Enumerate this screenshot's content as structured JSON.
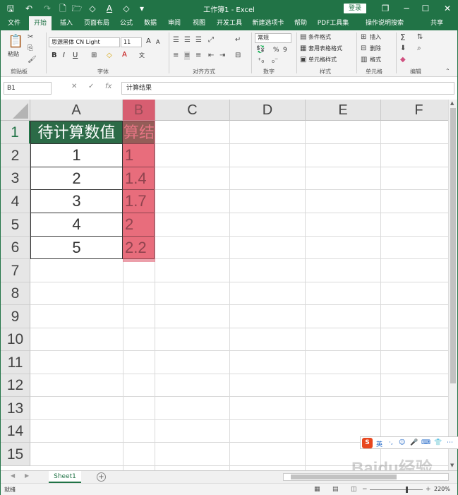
{
  "window": {
    "title": "工作簿1 - Excel",
    "login_label": "登录",
    "minimize": "─",
    "restore": "❐",
    "maximize": "☐",
    "close": "✕"
  },
  "quick_access": {
    "save": "🖫",
    "undo": "↶",
    "redo": "↷",
    "new": "🗋",
    "open": "🗁",
    "font_color": "A",
    "fill": "◇",
    "more": "▾"
  },
  "tabs": [
    "文件",
    "开始",
    "插入",
    "页面布局",
    "公式",
    "数据",
    "审阅",
    "视图",
    "开发工具",
    "新建选项卡",
    "帮助",
    "PDF工具集",
    "操作说明搜索",
    "共享"
  ],
  "active_tab": "开始",
  "ribbon": {
    "groups": {
      "clipboard": "剪贴板",
      "font": "字体",
      "alignment": "对齐方式",
      "number": "数字",
      "styles": "样式",
      "cells": "单元格",
      "editing": "编辑"
    },
    "paste_label": "粘贴",
    "font_name": "思源黑体 CN Light",
    "font_size": "11",
    "number_format": "常规",
    "percent": "%",
    "comma": "9",
    "styles_items": [
      "条件格式",
      "套用表格格式",
      "单元格样式"
    ],
    "cells_items": [
      "插入",
      "删除",
      "格式"
    ],
    "bold": "B",
    "italic": "I",
    "underline": "U",
    "grow_font": "A",
    "shrink_font": "A",
    "wen": "文"
  },
  "formula_bar": {
    "name_box": "B1",
    "cancel": "✕",
    "enter": "✓",
    "fx": "fx",
    "formula": "计算结果"
  },
  "sheet": {
    "columns": [
      "A",
      "B",
      "C",
      "D",
      "E",
      "F"
    ],
    "rows": [
      "1",
      "2",
      "3",
      "4",
      "5",
      "6",
      "7",
      "8",
      "9",
      "10",
      "11",
      "12",
      "13",
      "14",
      "15"
    ],
    "selected_column": "B",
    "selected_row": "1",
    "cells": {
      "A1": "待计算数值",
      "B1": "算结",
      "A2": "1",
      "B2": "1",
      "A3": "2",
      "B3": "1.4",
      "A4": "3",
      "B4": "1.7",
      "A5": "4",
      "B5": "2",
      "A6": "5",
      "B6": "2.2"
    }
  },
  "sheet_tabs": {
    "active": "Sheet1",
    "add": "+"
  },
  "status": {
    "ready": "就绪",
    "zoom": "220%"
  },
  "ime": {
    "brand": "S",
    "lang": "英",
    "items": [
      "·,",
      "☺",
      "🎤",
      "⌨",
      "👕",
      "⋯"
    ]
  },
  "watermark": "Baidu经验",
  "colors": {
    "excel_green": "#217346",
    "selection_pink": "#f5909a",
    "header_green": "#2c6b47"
  }
}
